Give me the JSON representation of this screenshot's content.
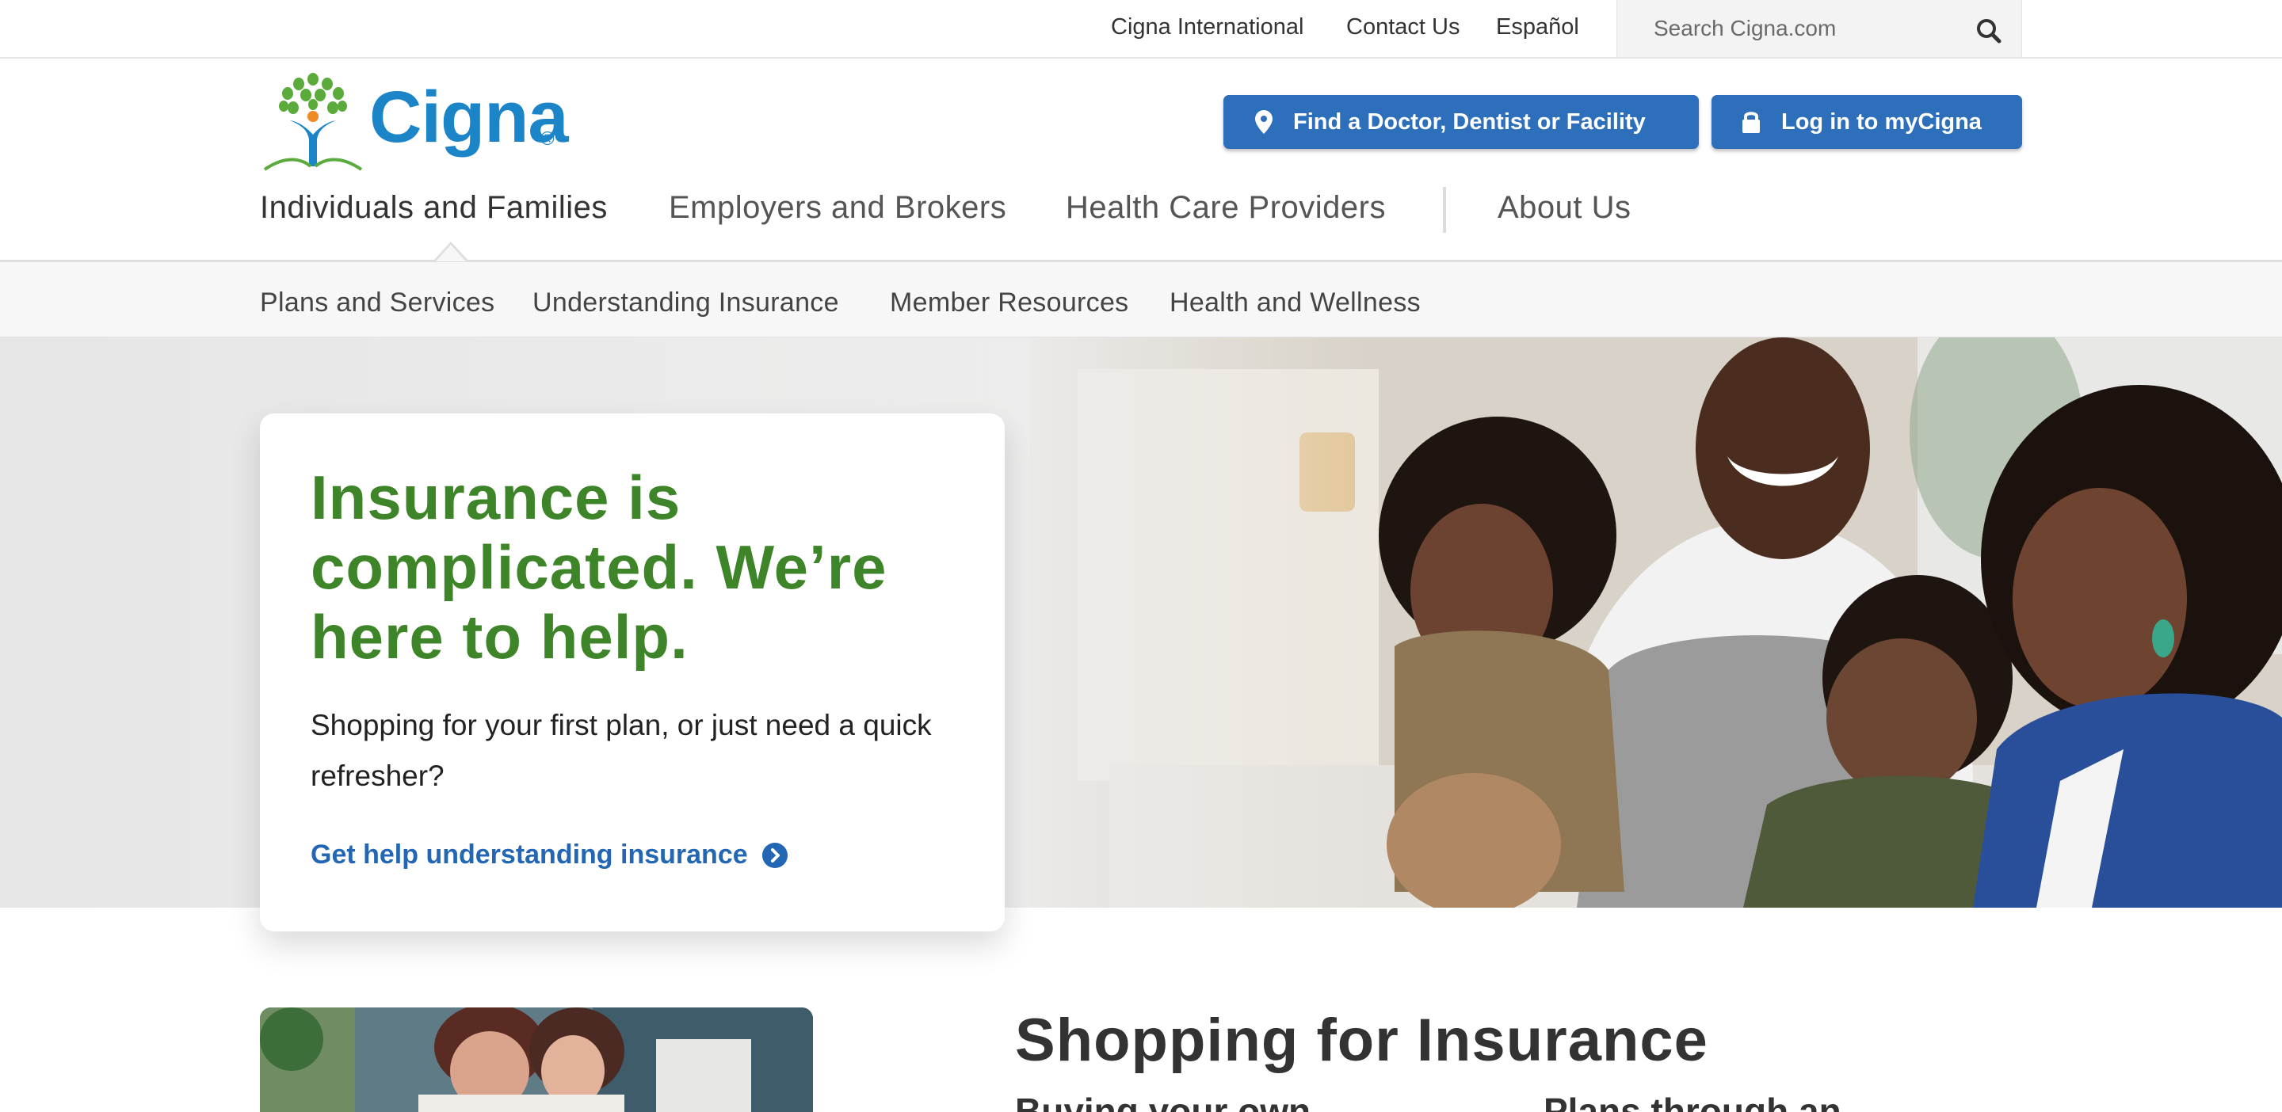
{
  "utility": {
    "links": [
      "Cigna International",
      "Contact Us",
      "Español"
    ],
    "search_placeholder": "Search Cigna.com"
  },
  "logo": {
    "wordmark": "Cigna",
    "registered": "®"
  },
  "header_buttons": {
    "find": "Find a Doctor, Dentist or Facility",
    "login": "Log in to myCigna"
  },
  "main_nav": {
    "items": [
      "Individuals and Families",
      "Employers and Brokers",
      "Health Care Providers",
      "About Us"
    ],
    "active": "Individuals and Families"
  },
  "sub_nav": {
    "items": [
      "Plans and Services",
      "Understanding Insurance",
      "Member Resources",
      "Health and Wellness"
    ]
  },
  "hero": {
    "title": "Insurance is complicated. We’re here to help.",
    "body": "Shopping for your first plan, or just need a quick refresher?",
    "link": "Get help understanding insurance"
  },
  "shopping": {
    "title": "Shopping for Insurance",
    "columns": [
      "Buying your own",
      "Plans through an"
    ]
  },
  "colors": {
    "brand_blue": "#2d6fbb",
    "logo_blue": "#1b85c8",
    "hero_green": "#3e8428",
    "link_blue": "#2367b4"
  },
  "icons": [
    "search-icon",
    "map-pin-icon",
    "lock-icon",
    "chevron-right-circle-icon",
    "cigna-tree-logo-icon"
  ]
}
